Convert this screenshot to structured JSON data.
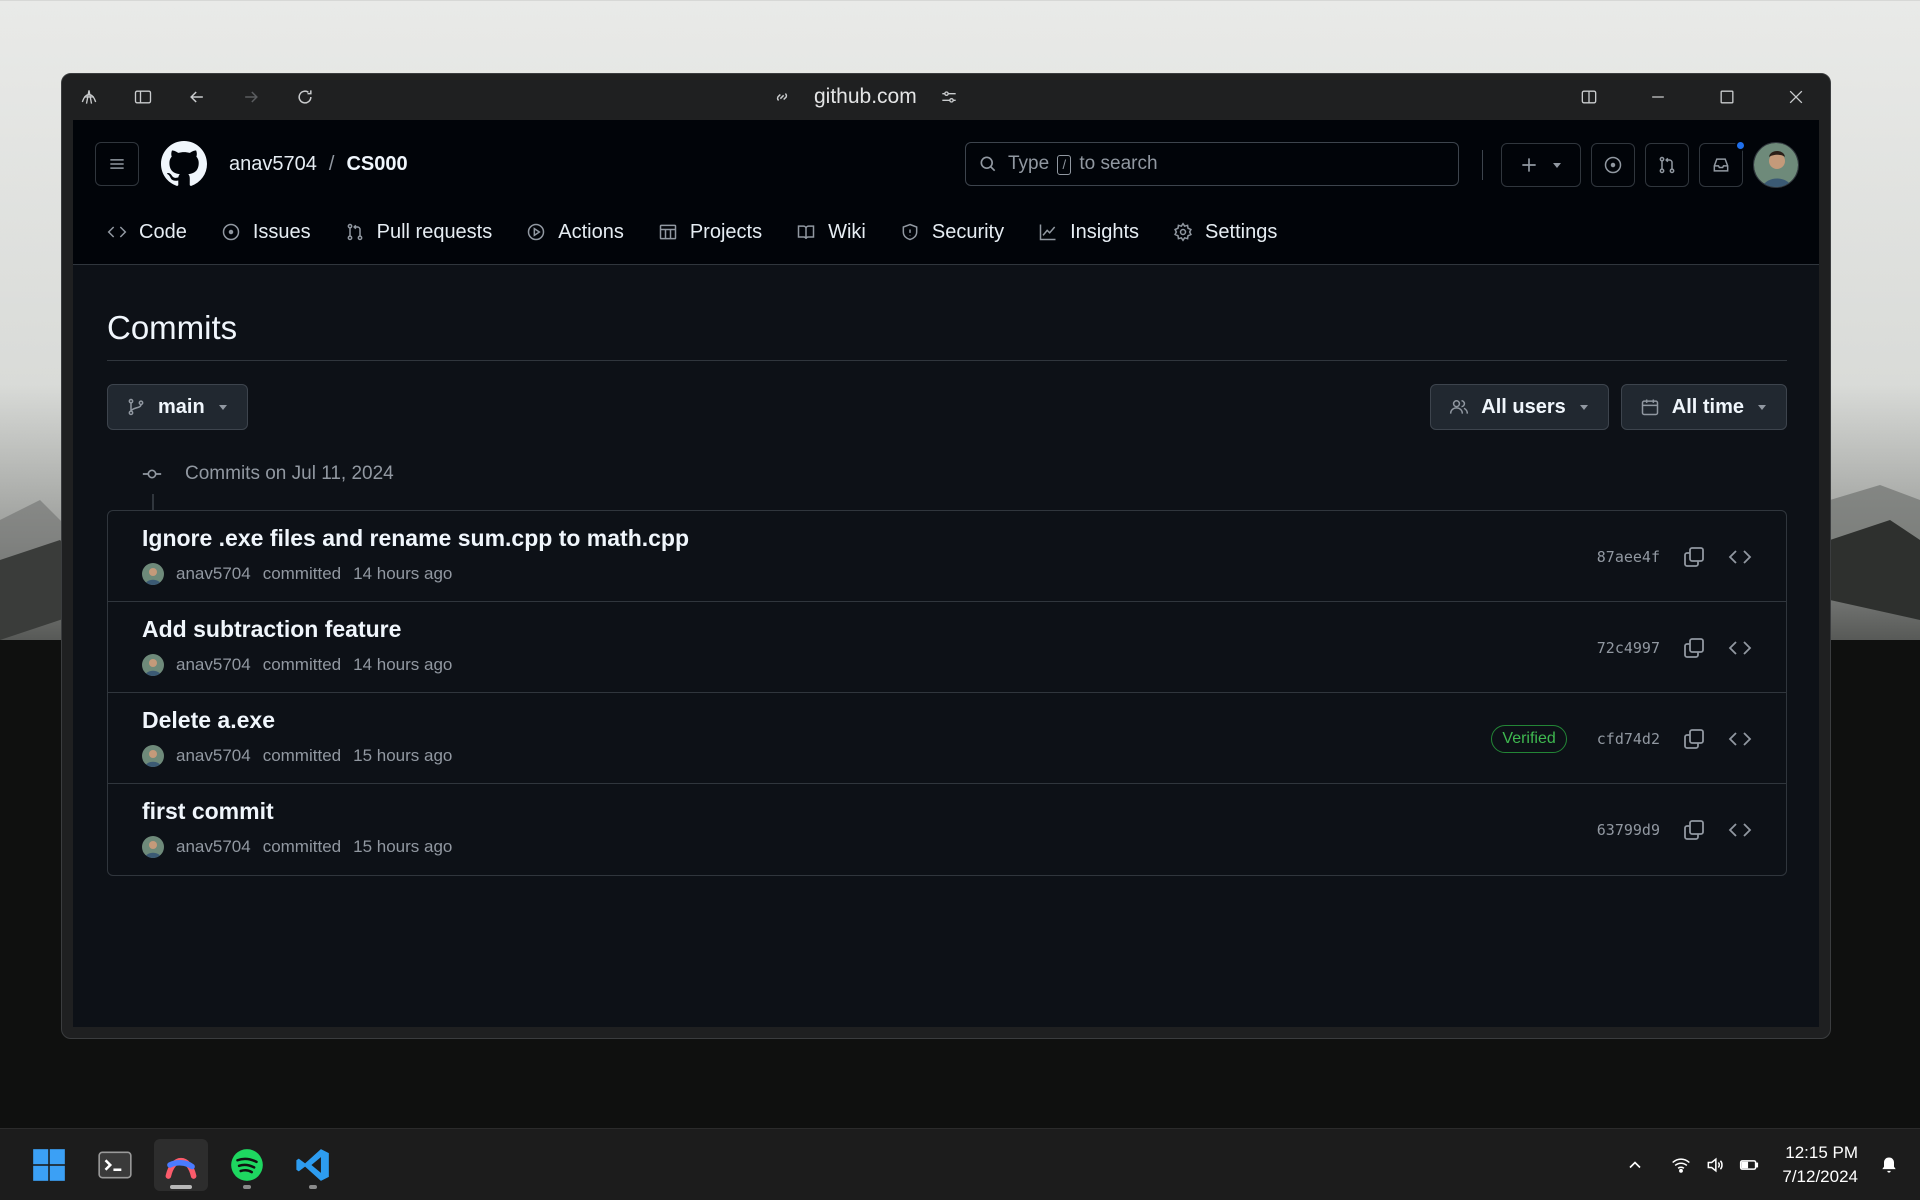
{
  "browser": {
    "url": "github.com"
  },
  "github": {
    "owner": "anav5704",
    "separator": "/",
    "repo": "CS000",
    "search": {
      "prefix": "Type",
      "key": "/",
      "suffix": "to search"
    },
    "nav": [
      {
        "label": "Code",
        "icon": "code-icon"
      },
      {
        "label": "Issues",
        "icon": "issue-icon"
      },
      {
        "label": "Pull requests",
        "icon": "pull-request-icon"
      },
      {
        "label": "Actions",
        "icon": "play-icon"
      },
      {
        "label": "Projects",
        "icon": "table-icon"
      },
      {
        "label": "Wiki",
        "icon": "book-icon"
      },
      {
        "label": "Security",
        "icon": "shield-icon"
      },
      {
        "label": "Insights",
        "icon": "graph-icon"
      },
      {
        "label": "Settings",
        "icon": "gear-icon"
      }
    ],
    "page_title": "Commits",
    "branch": "main",
    "filter_users": "All users",
    "filter_time": "All time",
    "commit_group_label": "Commits on Jul 11, 2024",
    "commits": [
      {
        "title": "Ignore .exe files and rename sum.cpp to math.cpp",
        "author": "anav5704",
        "action": "committed",
        "time": "14 hours ago",
        "sha": "87aee4f",
        "verified": ""
      },
      {
        "title": "Add subtraction feature",
        "author": "anav5704",
        "action": "committed",
        "time": "14 hours ago",
        "sha": "72c4997",
        "verified": ""
      },
      {
        "title": "Delete a.exe",
        "author": "anav5704",
        "action": "committed",
        "time": "15 hours ago",
        "sha": "cfd74d2",
        "verified": "Verified"
      },
      {
        "title": "first commit",
        "author": "anav5704",
        "action": "committed",
        "time": "15 hours ago",
        "sha": "63799d9",
        "verified": ""
      }
    ]
  },
  "taskbar": {
    "apps": [
      "windows-start",
      "terminal",
      "arc-browser",
      "spotify",
      "vscode"
    ],
    "time": "12:15 PM",
    "date": "7/12/2024"
  },
  "colors": {
    "accent": "#1f6feb",
    "verified": "#3fb950",
    "bg": "#0d1117",
    "header_bg": "#010409"
  }
}
